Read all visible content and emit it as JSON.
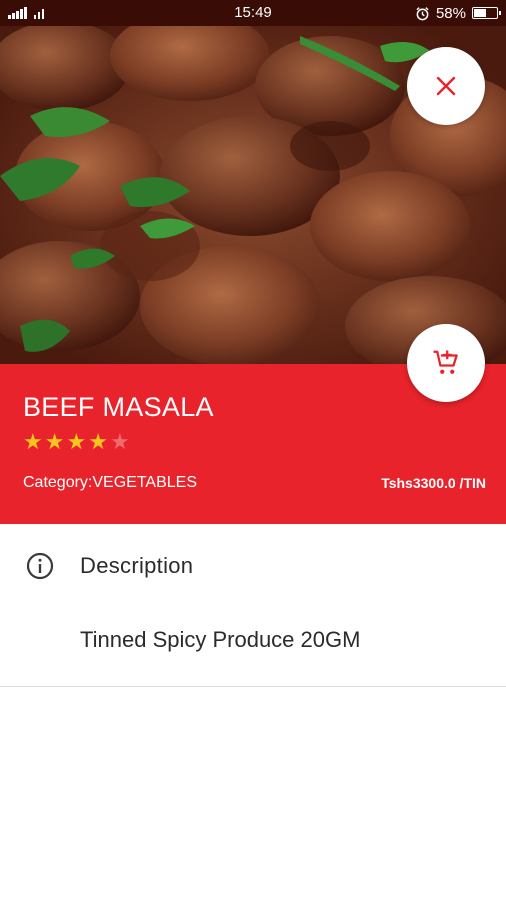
{
  "status_bar": {
    "time": "15:49",
    "battery_percent": "58%",
    "battery_level": 0.58,
    "icons": [
      "signal-icon",
      "wifi-icon",
      "alarm-icon",
      "battery-icon"
    ]
  },
  "hero": {
    "image": "beef-masala-photo",
    "close_icon": "close-icon",
    "cart_icon": "add-shopping-cart-icon"
  },
  "product": {
    "title": "BEEF MASALA",
    "rating": 4,
    "rating_max": 5,
    "category_label": "Category:",
    "category": "VEGETABLES",
    "price": "Tshs3300.0 /TIN"
  },
  "description": {
    "icon": "info-icon",
    "heading": "Description",
    "text": "Tinned Spicy Produce 20GM"
  },
  "colors": {
    "accent": "#e8232b",
    "star": "#f7c51e",
    "status_bar": "#3a0c06"
  }
}
